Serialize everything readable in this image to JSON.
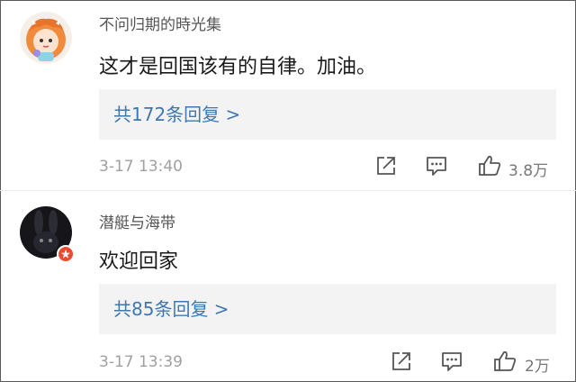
{
  "comments": [
    {
      "username": "不问归期的時光集",
      "text": "这才是回国该有的自律。加油。",
      "replies_label": "共172条回复 >",
      "time": "3-17 13:40",
      "likes": "3.8万",
      "avatar_icon": "cartoon-girl-avatar"
    },
    {
      "username": "潜艇与海带",
      "text": "欢迎回家",
      "replies_label": "共85条回复 >",
      "time": "3-17 13:39",
      "likes": "2万",
      "avatar_icon": "dark-rabbit-avatar",
      "badge_icon": "verified-badge-icon"
    }
  ],
  "colors": {
    "link": "#3f78b0",
    "reply_box_bg": "#f3f3f3",
    "muted": "#a0a0a0",
    "badge": "#e94b2e"
  }
}
